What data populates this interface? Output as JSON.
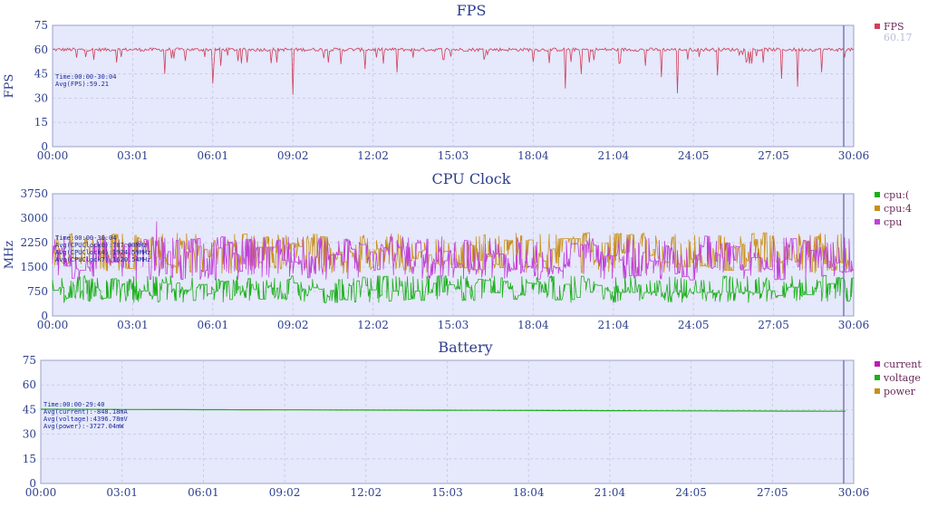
{
  "chart_data": [
    {
      "id": "fps",
      "type": "line",
      "title": "FPS",
      "ylabel": "FPS",
      "xlabel": "",
      "ylim": [
        0,
        75
      ],
      "yticks": [
        "0",
        "15",
        "30",
        "45",
        "60",
        "75"
      ],
      "xticks": [
        "00:00",
        "03:01",
        "06:01",
        "09:02",
        "12:02",
        "15:03",
        "18:04",
        "21:04",
        "24:05",
        "27:05",
        "30:06"
      ],
      "grid": true,
      "legend_position": "right",
      "legend": [
        {
          "name": "FPS",
          "color": "#d0405a",
          "value_label": "60.17"
        }
      ],
      "annotation": [
        "Time:00:00-30:04",
        "Avg(FPS):59.21"
      ],
      "series": [
        {
          "name": "FPS",
          "color": "#d0405a",
          "baseline": 60,
          "range": [
            57,
            61
          ],
          "dips_time_fraction_to_value": [
            [
              0.03,
              55
            ],
            [
              0.08,
              52
            ],
            [
              0.14,
              45
            ],
            [
              0.2,
              39
            ],
            [
              0.21,
              50
            ],
            [
              0.28,
              52
            ],
            [
              0.3,
              32
            ],
            [
              0.36,
              51
            ],
            [
              0.39,
              48
            ],
            [
              0.43,
              46
            ],
            [
              0.45,
              55
            ],
            [
              0.64,
              36
            ],
            [
              0.66,
              45
            ],
            [
              0.67,
              52
            ],
            [
              0.74,
              50
            ],
            [
              0.76,
              43
            ],
            [
              0.78,
              33
            ],
            [
              0.83,
              44
            ],
            [
              0.91,
              42
            ],
            [
              0.93,
              37
            ],
            [
              0.96,
              46
            ]
          ]
        }
      ]
    },
    {
      "id": "cpu",
      "type": "line",
      "title": "CPU Clock",
      "ylabel": "MHz",
      "xlabel": "",
      "ylim": [
        0,
        3750
      ],
      "yticks": [
        "0",
        "750",
        "1500",
        "2250",
        "3000",
        "3750"
      ],
      "xticks": [
        "00:00",
        "03:01",
        "06:01",
        "09:02",
        "12:02",
        "15:03",
        "18:04",
        "21:04",
        "24:05",
        "27:05",
        "30:06"
      ],
      "grid": true,
      "legend_position": "right",
      "legend": [
        {
          "name": "cpu:(",
          "color": "#1ab01a"
        },
        {
          "name": "cpu:4",
          "color": "#c8901a"
        },
        {
          "name": "cpu",
          "color": "#c040d8"
        }
      ],
      "annotation": [
        "Time:00:00-30:04",
        "Avg(CPUClock0):787.00MHz",
        "Avg(CPUClock4):1924.59MHz",
        "Avg(CPUClock7):1620.54MHz"
      ],
      "series": [
        {
          "name": "cpu0",
          "color": "#1ab01a",
          "range": [
            400,
            1250
          ],
          "mean": 787
        },
        {
          "name": "cpu4",
          "color": "#c8901a",
          "range": [
            1300,
            2550
          ],
          "mean": 1925
        },
        {
          "name": "cpu7",
          "color": "#c040d8",
          "range": [
            1100,
            2450
          ],
          "mean": 1621
        }
      ]
    },
    {
      "id": "battery",
      "type": "line",
      "title": "Battery",
      "ylabel": "",
      "xlabel": "",
      "ylim": [
        0,
        75
      ],
      "yticks": [
        "0",
        "15",
        "30",
        "45",
        "60",
        "75"
      ],
      "xticks": [
        "00:00",
        "03:01",
        "06:01",
        "09:02",
        "12:02",
        "15:03",
        "18:04",
        "21:04",
        "24:05",
        "27:05",
        "30:06"
      ],
      "grid": true,
      "legend_position": "right",
      "legend": [
        {
          "name": "current",
          "color": "#c01ab0"
        },
        {
          "name": "voltage",
          "color": "#1ab01a"
        },
        {
          "name": "power",
          "color": "#c8901a"
        }
      ],
      "annotation": [
        "Time:00:00-29:40",
        "Avg(current):-848.18mA",
        "Avg(voltage):4396.78mV",
        "Avg(power):-3727.04mW"
      ],
      "series": [
        {
          "name": "voltage",
          "color": "#1ab01a",
          "start": 45.2,
          "end": 44.0
        }
      ]
    }
  ]
}
